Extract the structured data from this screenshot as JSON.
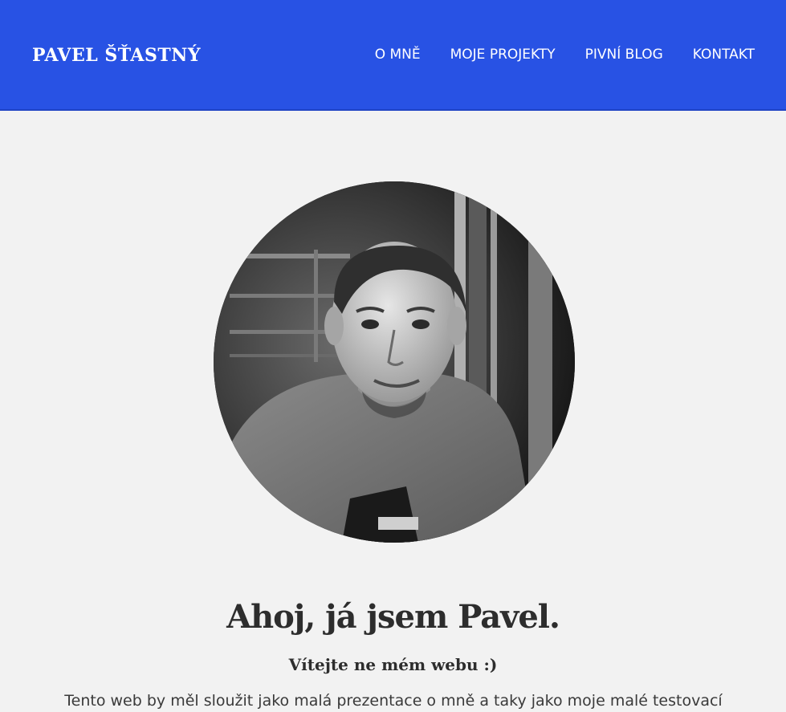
{
  "header": {
    "brand": "PAVEL ŠŤASTNÝ",
    "nav": [
      {
        "label": "O MNĚ"
      },
      {
        "label": "MOJE PROJEKTY"
      },
      {
        "label": "PIVNÍ BLOG"
      },
      {
        "label": "KONTAKT"
      }
    ]
  },
  "hero": {
    "headline": "Ahoj, já jsem Pavel.",
    "subtitle": "Vítejte ne mém webu :)",
    "body": "Tento web by měl sloužit jako malá prezentace o mně a taky jako moje malé testovací"
  },
  "colors": {
    "header_bg": "#2852e4",
    "page_bg": "#f2f2f2",
    "text": "#2d2d2d"
  }
}
